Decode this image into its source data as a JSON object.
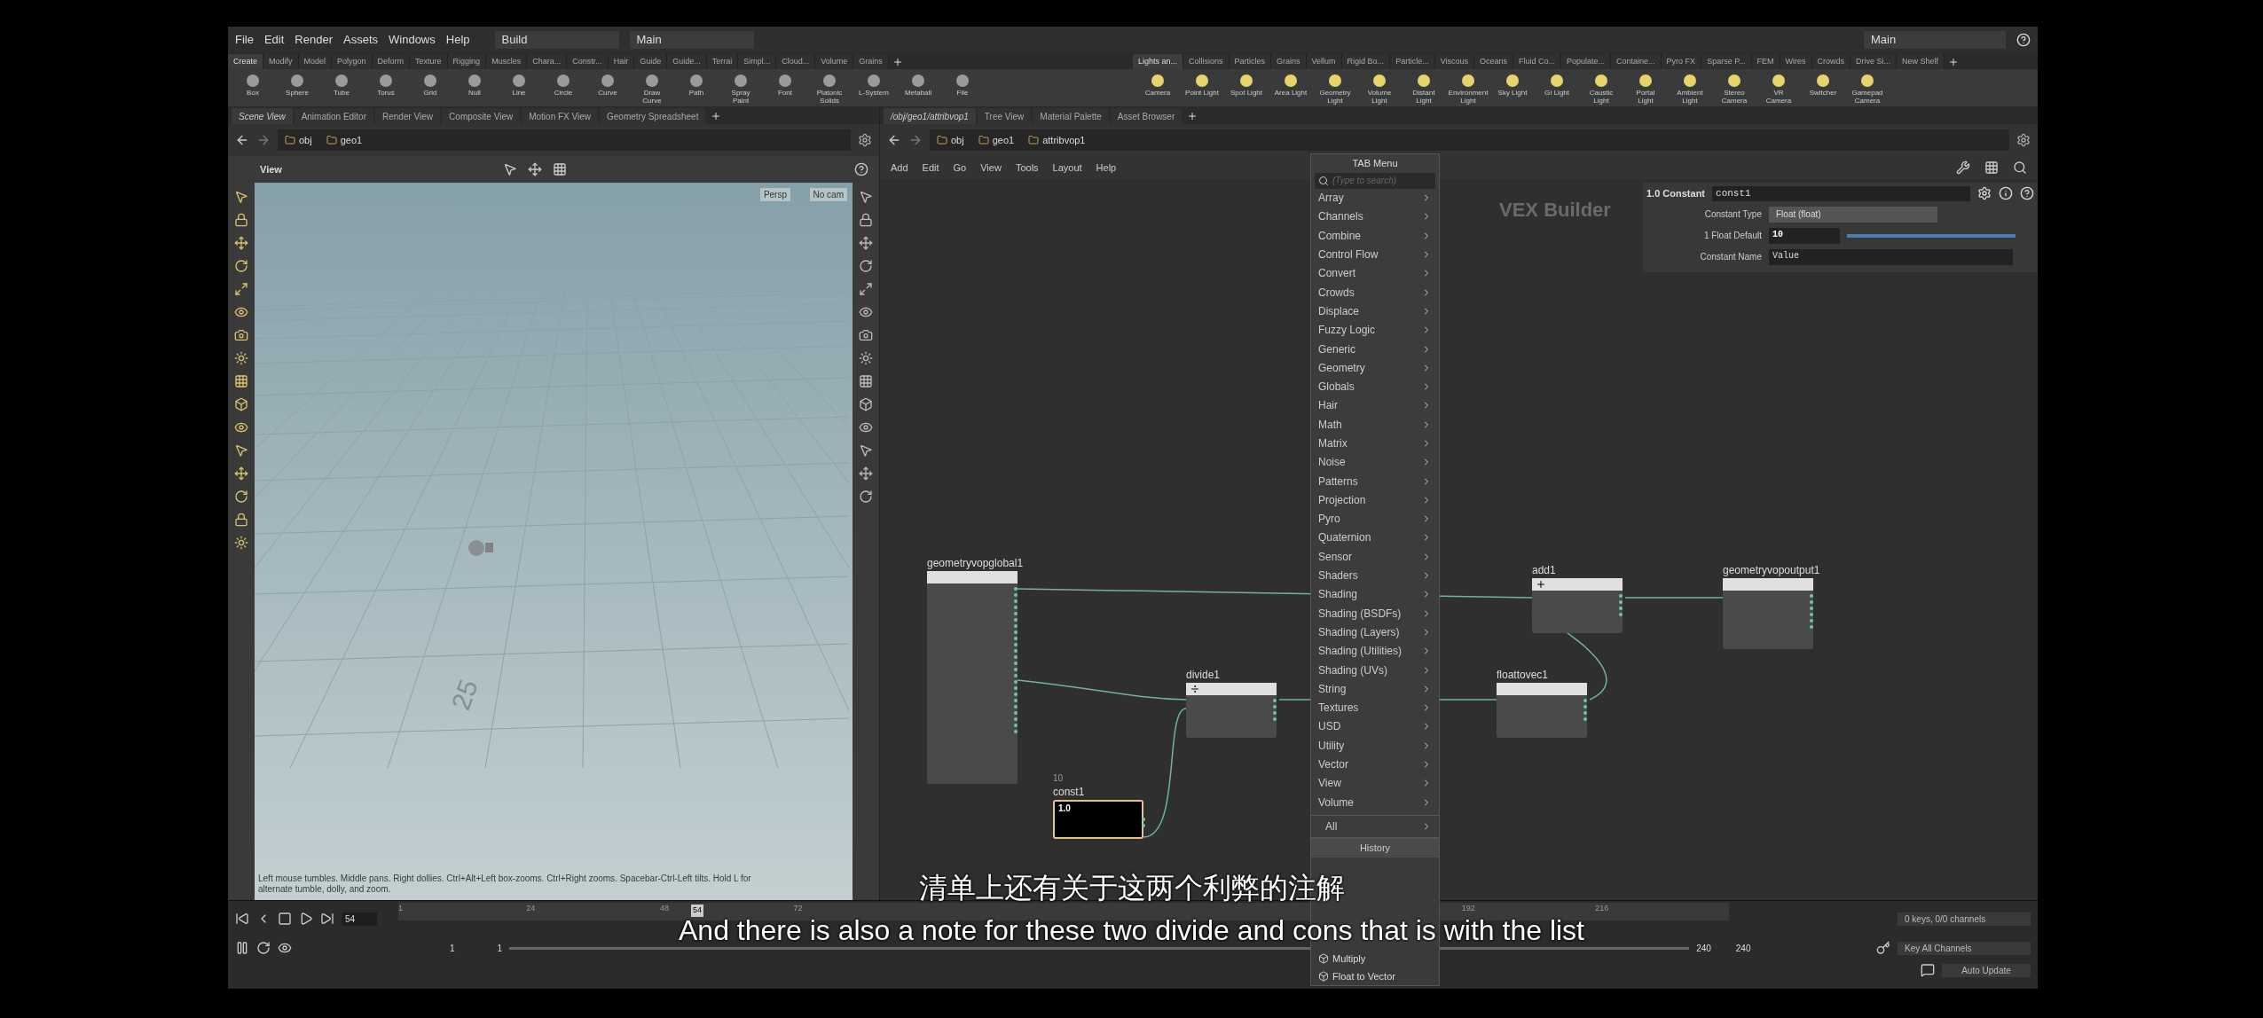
{
  "menu_bar": {
    "items": [
      "File",
      "Edit",
      "Render",
      "Assets",
      "Windows",
      "Help"
    ],
    "desktop": "Build",
    "layout": "Main",
    "right_layout": "Main"
  },
  "shelf_left": {
    "tabs": [
      {
        "label": "Create",
        "selected": true
      },
      {
        "label": "Modify",
        "selected": false
      },
      {
        "label": "Model",
        "selected": false
      },
      {
        "label": "Polygon",
        "selected": false
      },
      {
        "label": "Deform",
        "selected": false
      },
      {
        "label": "Texture",
        "selected": false
      },
      {
        "label": "Rigging",
        "selected": false
      },
      {
        "label": "Muscles",
        "selected": false
      },
      {
        "label": "Chara...",
        "selected": false
      },
      {
        "label": "Constr...",
        "selected": false
      },
      {
        "label": "Hair",
        "selected": false
      },
      {
        "label": "Guide",
        "selected": false
      },
      {
        "label": "Guide...",
        "selected": false
      },
      {
        "label": "Terrai",
        "selected": false
      },
      {
        "label": "Simpl...",
        "selected": false
      },
      {
        "label": "Cloud...",
        "selected": false
      },
      {
        "label": "Volume",
        "selected": false
      },
      {
        "label": "Grains",
        "selected": false
      }
    ],
    "tools": [
      "Box",
      "Sphere",
      "Tube",
      "Torus",
      "Grid",
      "Null",
      "Line",
      "Circle",
      "Curve",
      "Draw Curve",
      "Path",
      "Spray Paint",
      "Font",
      "Platonic Solids",
      "L-System",
      "Metaball",
      "File"
    ]
  },
  "shelf_right": {
    "tabs": [
      {
        "label": "Lights an...",
        "selected": true
      },
      {
        "label": "Collisions",
        "selected": false
      },
      {
        "label": "Particles",
        "selected": false
      },
      {
        "label": "Grains",
        "selected": false
      },
      {
        "label": "Vellum",
        "selected": false
      },
      {
        "label": "Rigid Bo...",
        "selected": false
      },
      {
        "label": "Particle...",
        "selected": false
      },
      {
        "label": "Viscous",
        "selected": false
      },
      {
        "label": "Oceans",
        "selected": false
      },
      {
        "label": "Fluid Co...",
        "selected": false
      },
      {
        "label": "Populate...",
        "selected": false
      },
      {
        "label": "Containe...",
        "selected": false
      },
      {
        "label": "Pyro FX",
        "selected": false
      },
      {
        "label": "Sparse P...",
        "selected": false
      },
      {
        "label": "FEM",
        "selected": false
      },
      {
        "label": "Wires",
        "selected": false
      },
      {
        "label": "Crowds",
        "selected": false
      },
      {
        "label": "Drive Si...",
        "selected": false
      },
      {
        "label": "New Shelf",
        "selected": false
      }
    ],
    "tools": [
      "Camera",
      "Point Light",
      "Spot Light",
      "Area Light",
      "Geometry Light",
      "Volume Light",
      "Distant Light",
      "Environment Light",
      "Sky Light",
      "GI Light",
      "Caustic Light",
      "Portal Light",
      "Ambient Light",
      "Stereo Camera",
      "VR Camera",
      "Switcher",
      "Gamepad Camera"
    ]
  },
  "left_pane": {
    "tabs": [
      {
        "label": "Scene View",
        "selected": true
      },
      {
        "label": "Animation Editor",
        "selected": false
      },
      {
        "label": "Render View",
        "selected": false
      },
      {
        "label": "Composite View",
        "selected": false
      },
      {
        "label": "Motion FX View",
        "selected": false
      },
      {
        "label": "Geometry Spreadsheet",
        "selected": false
      }
    ],
    "path": [
      "obj",
      "geo1"
    ],
    "viewport_title": "View",
    "camera": "Persp",
    "cam_menu": "No cam",
    "floor_label": "25",
    "hint": "Left mouse tumbles. Middle pans. Right dollies. Ctrl+Alt+Left box-zooms. Ctrl+Right zooms. Spacebar-Ctrl-Left tilts. Hold L for alternate tumble, dolly, and zoom."
  },
  "right_pane": {
    "tabs": [
      {
        "label": "/obj/geo1/attribvop1",
        "selected": true
      },
      {
        "label": "Tree View",
        "selected": false
      },
      {
        "label": "Material Palette",
        "selected": false
      },
      {
        "label": "Asset Browser",
        "selected": false
      }
    ],
    "path": [
      "obj",
      "geo1",
      "attribvop1"
    ],
    "menu": [
      "Add",
      "Edit",
      "Go",
      "View",
      "Tools",
      "Layout",
      "Help"
    ],
    "context_label": "VEX Builder",
    "nodes": [
      {
        "name": "geometryvopglobal1",
        "kind": "global"
      },
      {
        "name": "add1",
        "kind": "add"
      },
      {
        "name": "geometryvopoutput1",
        "kind": "output"
      },
      {
        "name": "divide1",
        "kind": "divide"
      },
      {
        "name": "floattovec1",
        "kind": "floattovec"
      },
      {
        "name": "const1",
        "kind": "constant",
        "value": "10",
        "icon_text": "1.0"
      }
    ],
    "parameters": {
      "icon_text": "1.0",
      "type_label": "Constant",
      "node_name": "const1",
      "fields": [
        {
          "kind": "menu",
          "label": "Constant Type",
          "value": "Float (float)"
        },
        {
          "kind": "slider",
          "label": "1 Float Default",
          "value": "10",
          "level": 1
        },
        {
          "kind": "text",
          "label": "Constant Name",
          "value": "Value"
        }
      ]
    }
  },
  "tab_menu": {
    "title": "TAB Menu",
    "placeholder": "(Type to search)",
    "items": [
      "Array",
      "Channels",
      "Combine",
      "Control Flow",
      "Convert",
      "Crowds",
      "Displace",
      "Fuzzy Logic",
      "Generic",
      "Geometry",
      "Globals",
      "Hair",
      "Math",
      "Matrix",
      "Noise",
      "Patterns",
      "Projection",
      "Pyro",
      "Quaternion",
      "Sensor",
      "Shaders",
      "Shading",
      "Shading (BSDFs)",
      "Shading (Layers)",
      "Shading (Utilities)",
      "Shading (UVs)",
      "String",
      "Textures",
      "USD",
      "Utility",
      "Vector",
      "View",
      "Volume"
    ],
    "all": "All",
    "history_title": "History",
    "history": [
      "Multiply",
      "Float to Vector"
    ]
  },
  "timeline": {
    "frame": "54",
    "current": "54",
    "ticks": [
      "1",
      "24",
      "48",
      "72",
      "192",
      "216"
    ],
    "start": "1",
    "start_field": "1",
    "end": "240",
    "end_field": "240",
    "keys": "0 keys, 0/0 channels",
    "key_all": "Key All Channels",
    "auto_update": "Auto Update"
  },
  "subtitles": [
    "清单上还有关于这两个利弊的注解",
    "And there is also a note for these two divide and cons that is with the list"
  ]
}
